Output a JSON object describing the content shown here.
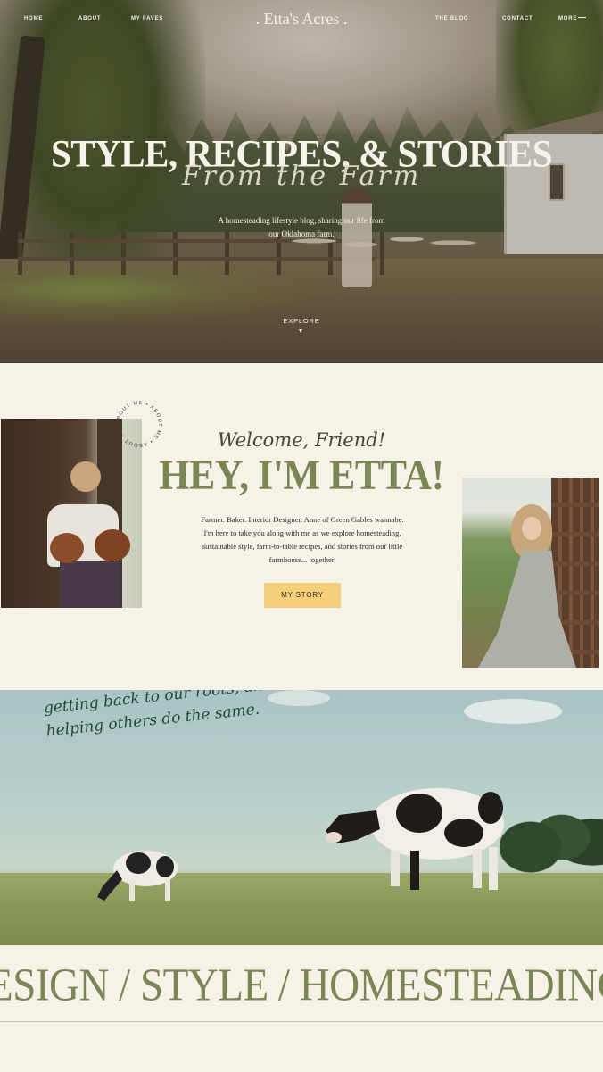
{
  "nav": {
    "left_links": [
      "HOME",
      "ABOUT",
      "MY FAVES"
    ],
    "brand": ". Etta's Acres .",
    "right_links": [
      "THE BLOG",
      "CONTACT",
      "MORE"
    ]
  },
  "hero": {
    "title": "STYLE, RECIPES, & STORIES",
    "script": "From the Farm",
    "subtitle": "A homesteading lifestyle blog, sharing our life from our Oklahoma farm.",
    "explore_label": "EXPLORE"
  },
  "about": {
    "badge_text": "ABOUT ME • ABOUT ME • ABOUT ME •",
    "welcome": "Welcome, Friend!",
    "heading": "HEY, I'M ETTA!",
    "body": "Farmer. Baker. Interior Designer. Anne of Green Gables wannabe. I'm here to take you along with me as we explore homesteading, sustainable style, farm-to-table recipes, and stories from our little farmhouse... together.",
    "button_label": "MY STORY"
  },
  "cows": {
    "quote": "I believe in the simple life, in getting back to our roots, and helping others do the same."
  },
  "marquee": {
    "text": "ESIGN / STYLE / HOMESTEADING / BAK"
  },
  "colors": {
    "accent_green": "#7a8755",
    "button_yellow": "#f6cf7a",
    "cream_bg": "#f6f2e8",
    "script_green": "#1f4a3a"
  }
}
